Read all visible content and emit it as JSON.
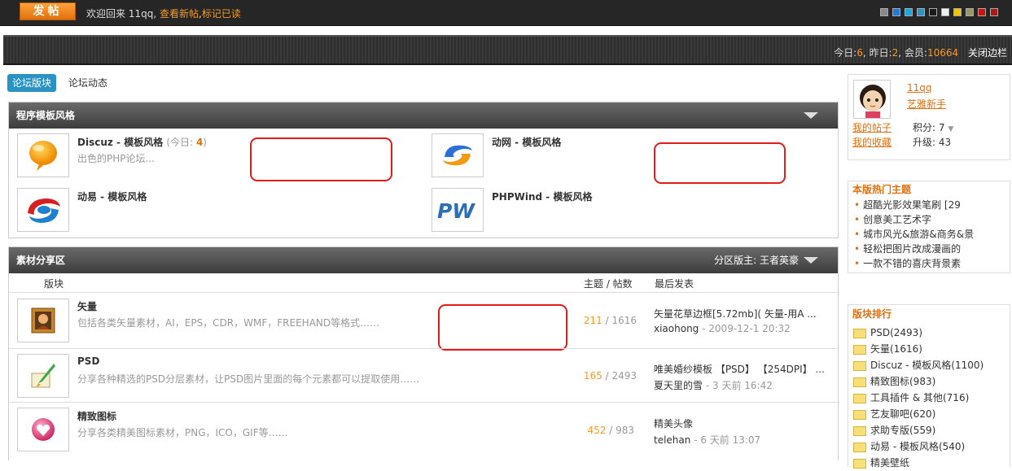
{
  "topbar": {
    "post_button": "发帖",
    "welcome_prefix": "欢迎回来 11qq,",
    "view_new": "查看新帖",
    "sep": ",",
    "mark_read": "标记已读",
    "skin_colors": [
      "#888888",
      "#1e7bd6",
      "#1aa7e0",
      "#2a93c4",
      "#1a1a1a",
      "#eeeeee",
      "#f5c400",
      "#999966",
      "#cc1111",
      "#aa1a1a"
    ]
  },
  "stats": {
    "today_label": "今日:",
    "today": "6",
    "yesterday_label": ", 昨日:",
    "yesterday": "2",
    "members_label": ", 会员:",
    "members": "10664",
    "close_sidebar": "关闭边栏"
  },
  "tabs": [
    "论坛版块",
    "论坛动态"
  ],
  "templates": {
    "title": "程序模板风格",
    "forums": [
      {
        "name": "Discuz - 模板风格",
        "today_label": "(今日: ",
        "today": "4",
        "today_end": ")",
        "desc": "出色的PHP论坛..."
      },
      {
        "name": "动网 - 模板风格",
        "desc": ""
      },
      {
        "name": "动易 - 模板风格",
        "desc": ""
      },
      {
        "name": "PHPWind - 模板风格",
        "desc": ""
      }
    ]
  },
  "materials": {
    "title": "素材分享区",
    "moderator_label": "分区版主:",
    "moderator": "王者英豪",
    "col_forum": "版块",
    "col_counts": "主题 / 帖数",
    "col_last": "最后发表",
    "rows": [
      {
        "name": "矢量",
        "desc": "包括各类矢量素材，AI，EPS，CDR，WMF，FREEHAND等格式……",
        "topics": "211",
        "posts": "/ 1616",
        "last_title": "矢量花草边框[5.72mb]( 矢量-用A ...",
        "last_user": "xiaohong",
        "last_time": "- 2009-12-1 20:32"
      },
      {
        "name": "PSD",
        "desc": "分享各种精选的PSD分层素材，让PSD图片里面的每个元素都可以提取使用……",
        "topics": "165",
        "posts": "/ 2493",
        "last_title": "唯美婚纱模板 【PSD】 【254DPI】 ...",
        "last_user": "夏天里的雪",
        "last_time": "- 3 天前 16:42"
      },
      {
        "name": "精致图标",
        "desc": "分享各类精美图标素材，PNG，ICO，GIF等……",
        "topics": "452",
        "posts": "/ 983",
        "last_title": "精美头像",
        "last_user": "telehan",
        "last_time": "- 6 天前 13:07"
      }
    ]
  },
  "user": {
    "name": "11qq",
    "level": "艺雅新手",
    "my_posts": "我的帖子",
    "my_favs": "我的收藏",
    "points": "积分: 7",
    "upgrade": "升级: 43"
  },
  "hot": {
    "title": "本版热门主题",
    "items": [
      "超酷光影效果笔刷 [29",
      "创意美工艺术字",
      "城市风光&旅游&商务&景",
      "轻松把图片改成漫画的",
      "一款不错的喜庆背景素"
    ]
  },
  "ranking": {
    "title": "版块排行",
    "items": [
      "PSD(2493)",
      "矢量(1616)",
      "Discuz - 模板风格(1100)",
      "精致图标(983)",
      "工具插件 & 其他(716)",
      "艺友聊吧(620)",
      "求助专版(559)",
      "动易 - 模板风格(540)",
      "精美壁纸"
    ]
  }
}
